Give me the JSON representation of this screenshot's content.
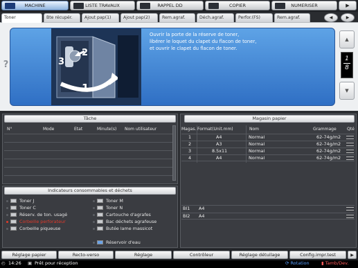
{
  "modes": [
    {
      "label": "MACHINE",
      "active": true
    },
    {
      "label": "LISTE TRAVAUX",
      "active": false
    },
    {
      "label": "RAPPEL DD",
      "active": false
    },
    {
      "label": "COPIER",
      "active": false
    },
    {
      "label": "NUMERISER",
      "active": false
    }
  ],
  "tabs": [
    "Toner",
    "Bte récupér.",
    "Ajout pap(1)",
    "Ajout pap(2)",
    "Rem.agraf.",
    "Déch.agraf.",
    "Perfor.(FS)",
    "Rem.agraf."
  ],
  "help_icon": "?",
  "instruction": {
    "line1": "Ouvrir la porte de la réserve de toner,",
    "line2": "libérer le loquet du clapet du flacon de toner,",
    "line3": "et ouvrir le clapet du flacon de toner."
  },
  "steps": {
    "s1": "1",
    "s2": "2",
    "s3": "3"
  },
  "page_indicator": {
    "current": "1",
    "total": "8"
  },
  "task": {
    "title": "Tâche",
    "columns": [
      "N°",
      "Mode",
      "Etat",
      "Minute(s)",
      "Nom utilisateur"
    ]
  },
  "consumables": {
    "title": "Indicateurs consommables et déchets",
    "left": [
      "Toner J",
      "Toner C",
      "Réserv. de ton. usagé",
      "Corbeille perforateur",
      "Corbeille piqueuse"
    ],
    "right": [
      "Toner M",
      "Toner N",
      "Cartouche d'agrafes",
      "Bac déchets agrafeuse",
      "Butée lame massicot",
      "Réservoir d'eau"
    ],
    "alert_color": "#e23a2a"
  },
  "paper": {
    "title": "Magasin papier",
    "columns": [
      "Magas.",
      "Format(Unit.mm)",
      "Nom",
      "Grammage",
      "Qté"
    ],
    "rows": [
      {
        "tray": "1",
        "size": "A4",
        "name": "Normal",
        "weight": "62-74g/m2"
      },
      {
        "tray": "2",
        "size": "A3",
        "name": "Normal",
        "weight": "62-74g/m2"
      },
      {
        "tray": "3",
        "size": "8.5x11",
        "name": "Normal",
        "weight": "62-74g/m2"
      },
      {
        "tray": "4",
        "size": "A4",
        "name": "Normal",
        "weight": "62-74g/m2"
      }
    ],
    "bypass": [
      {
        "tray": "BI1",
        "size": "A4"
      },
      {
        "tray": "BI2",
        "size": "A4"
      }
    ]
  },
  "bottom_buttons": [
    "Réglage papier",
    "Recto-verso",
    "Réglage",
    "Contrôleur",
    "Réglage détuilage",
    "Config.impr.test"
  ],
  "status": {
    "time": "14:26",
    "message": "Prêt pour réception",
    "rotation": "Rotation",
    "tamb": "Tamb/Dev."
  },
  "colors": {
    "accent": "#2f6fc4",
    "panel_blue": "#3e86d4",
    "status_blue": "#5aa0ff",
    "status_red": "#ff5c5c"
  }
}
